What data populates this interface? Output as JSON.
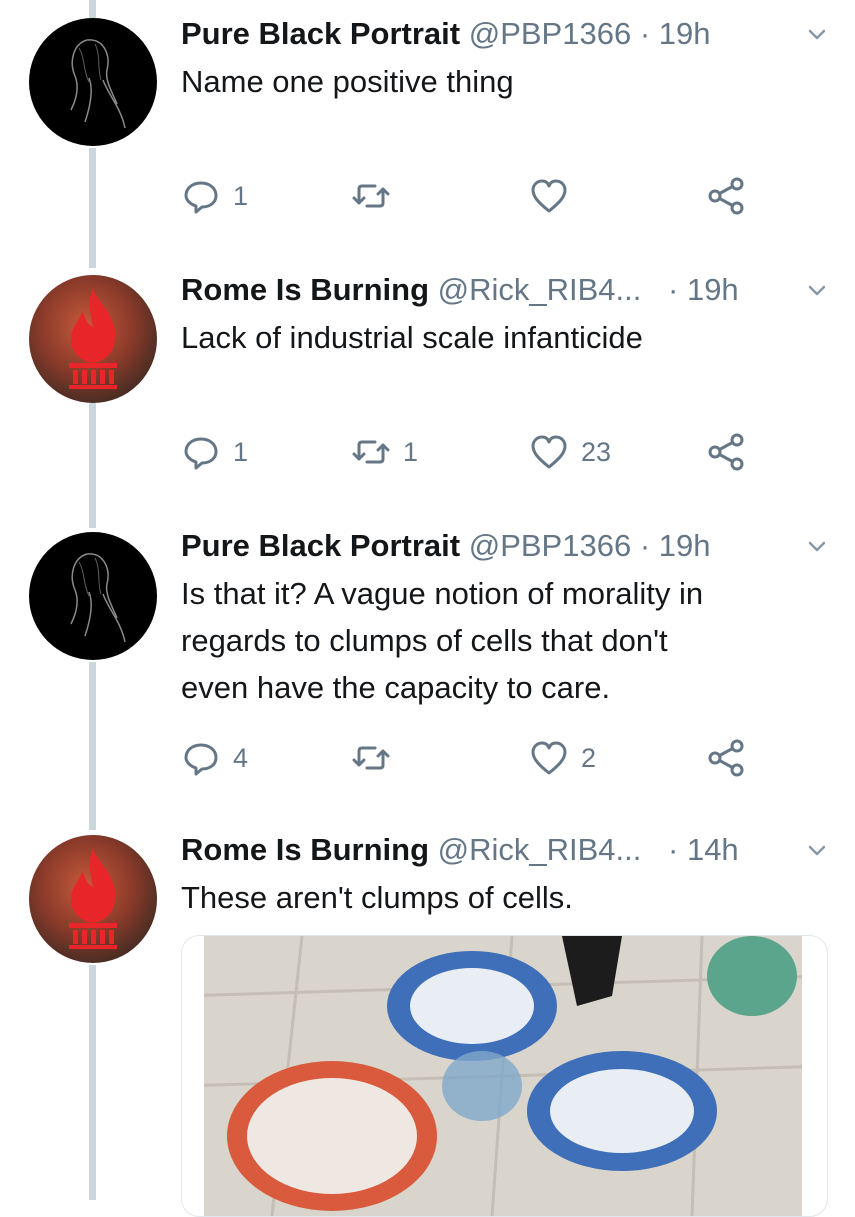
{
  "tweets": [
    {
      "name": "Pure Black Portrait",
      "handle": "@PBP1366",
      "time": "· 19h",
      "text": "Name one positive thing",
      "replies": "1",
      "retweets": "",
      "likes": "",
      "avatar": "dark-portrait-avatar"
    },
    {
      "name": "Rome Is Burning",
      "handle": "@Rick_RIB4...",
      "time": "· 19h",
      "text": "Lack of industrial scale infanticide",
      "replies": "1",
      "retweets": "1",
      "likes": "23",
      "avatar": "flame-logo-avatar"
    },
    {
      "name": "Pure Black Portrait",
      "handle": "@PBP1366",
      "time": "· 19h",
      "text_lines": [
        "Is that it? A vague notion of morality in",
        "regards to clumps of cells that don't",
        "even have the capacity to care."
      ],
      "replies": "4",
      "retweets": "",
      "likes": "2",
      "avatar": "dark-portrait-avatar"
    },
    {
      "name": "Rome Is Burning",
      "handle": "@Rick_RIB4...",
      "time": "· 14h",
      "text": "These aren't clumps of cells.",
      "avatar": "flame-logo-avatar",
      "media": "attached-photo"
    }
  ],
  "icons": {
    "reply": "reply-icon",
    "retweet": "retweet-icon",
    "like": "heart-icon",
    "share": "share-icon",
    "menu": "chevron-down-icon"
  },
  "colors": {
    "text": "#14171a",
    "secondary": "#657786",
    "thread_line": "#ccd6dd",
    "flame": "#e8262a"
  }
}
